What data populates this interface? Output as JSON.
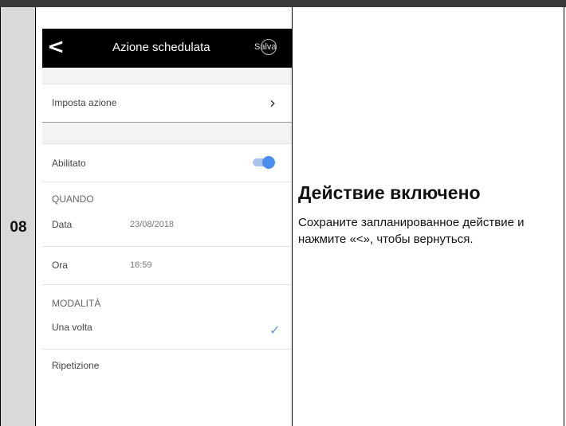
{
  "step_number": "08",
  "phone": {
    "header": {
      "back_label": "<",
      "title": "Azione schedulata",
      "save_label": "Salva"
    },
    "set_action": {
      "label": "Imposta azione"
    },
    "enabled": {
      "label": "Abilitato",
      "value": true
    },
    "when": {
      "section_label": "QUANDO",
      "date_label": "Data",
      "date_value": "23/08/2018",
      "time_label": "Ora",
      "time_value": "16:59"
    },
    "mode": {
      "section_label": "MODALITÀ",
      "options": [
        {
          "label": "Una volta",
          "selected": true
        },
        {
          "label": "Ripetizione",
          "selected": false
        }
      ]
    }
  },
  "description": {
    "title": "Действие включено",
    "body": "Сохраните запланированное действие и нажмите «<», чтобы вернуться."
  },
  "colors": {
    "toggle_on": "#4a8ef0",
    "checkmark": "#5a9be8",
    "header_bg": "#000000",
    "step_column_bg": "#d9d9d9"
  },
  "icons": {
    "back": "chevron-left-icon",
    "set_action": "chevron-right-icon",
    "selected_mode": "checkmark-icon"
  }
}
